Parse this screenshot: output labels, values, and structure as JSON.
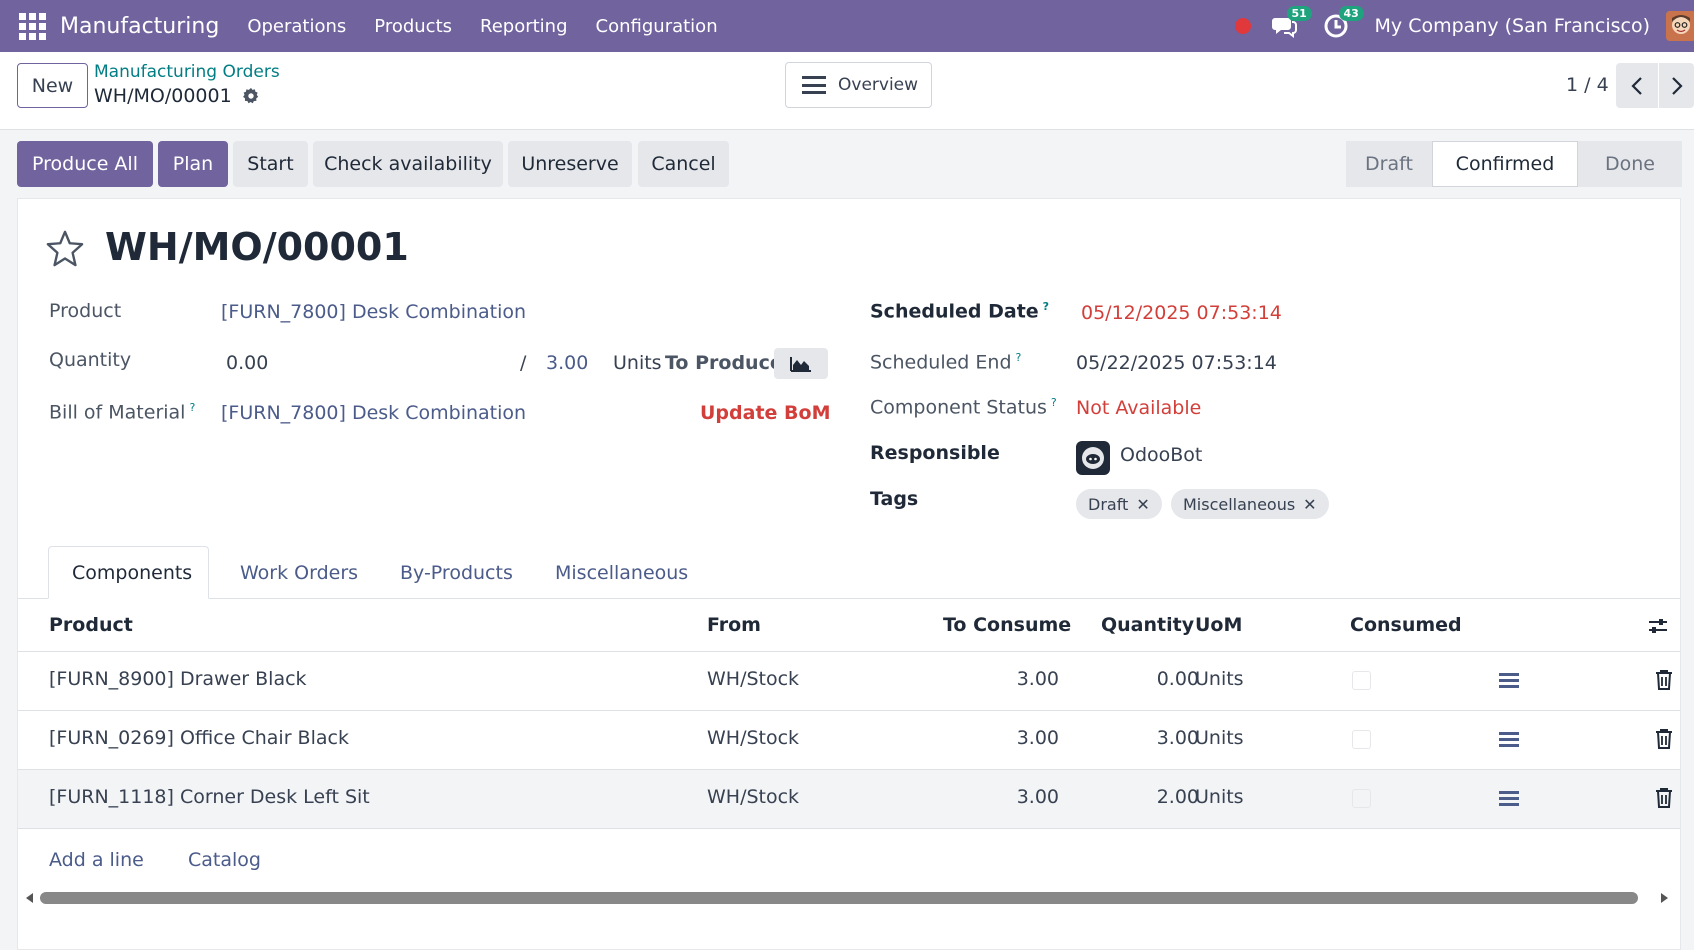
{
  "topbar": {
    "app_name": "Manufacturing",
    "menu": [
      "Operations",
      "Products",
      "Reporting",
      "Configuration"
    ],
    "messages_count": "51",
    "activities_count": "43",
    "company": "My Company (San Francisco)"
  },
  "control": {
    "new_label": "New",
    "breadcrumb_parent": "Manufacturing Orders",
    "breadcrumb_current": "WH/MO/00001",
    "overview_label": "Overview",
    "pager": "1 / 4"
  },
  "actions": {
    "produce_all": "Produce All",
    "plan": "Plan",
    "start": "Start",
    "check_availability": "Check availability",
    "unreserve": "Unreserve",
    "cancel": "Cancel"
  },
  "status": {
    "stages": [
      "Draft",
      "Confirmed",
      "Done"
    ],
    "current": "Confirmed"
  },
  "form": {
    "title": "WH/MO/00001",
    "product_label": "Product",
    "product_value": "[FURN_7800] Desk Combination",
    "quantity_label": "Quantity",
    "quantity_value": "0.00",
    "slash": "/",
    "quantity_target": "3.00",
    "units_label": "Units",
    "to_produce_label": "To Produce",
    "bom_label": "Bill of Material",
    "bom_value": "[FURN_7800] Desk Combination",
    "update_bom": "Update BoM",
    "scheduled_date_label": "Scheduled Date",
    "scheduled_date_value": "05/12/2025 07:53:14",
    "scheduled_end_label": "Scheduled End",
    "scheduled_end_value": "05/22/2025 07:53:14",
    "component_status_label": "Component Status",
    "component_status_value": "Not Available",
    "responsible_label": "Responsible",
    "responsible_value": "OdooBot",
    "tags_label": "Tags",
    "tags": [
      "Draft",
      "Miscellaneous"
    ],
    "help_mark": "?"
  },
  "tabs": [
    "Components",
    "Work Orders",
    "By-Products",
    "Miscellaneous"
  ],
  "table": {
    "headers": {
      "product": "Product",
      "from": "From",
      "to_consume": "To Consume",
      "quantity": "Quantity",
      "uom": "UoM",
      "consumed": "Consumed"
    },
    "rows": [
      {
        "product": "[FURN_8900] Drawer Black",
        "from": "WH/Stock",
        "to_consume": "3.00",
        "quantity": "0.00",
        "uom": "Units"
      },
      {
        "product": "[FURN_0269] Office Chair Black",
        "from": "WH/Stock",
        "to_consume": "3.00",
        "quantity": "3.00",
        "uom": "Units"
      },
      {
        "product": "[FURN_1118] Corner Desk Left Sit",
        "from": "WH/Stock",
        "to_consume": "3.00",
        "quantity": "2.00",
        "uom": "Units"
      }
    ],
    "add_line": "Add a line",
    "catalog": "Catalog"
  }
}
